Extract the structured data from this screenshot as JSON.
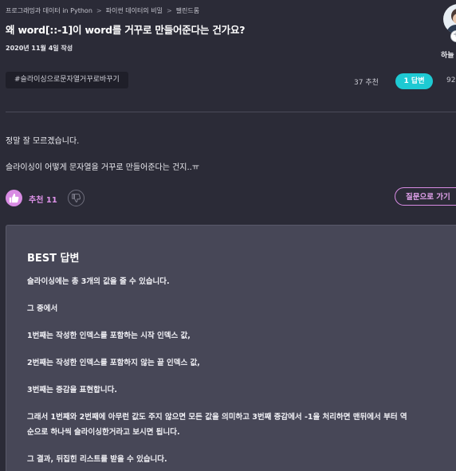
{
  "breadcrumb": {
    "items": [
      "프로그래밍과 데이터 in Python",
      "파이썬 데이터의 비밀",
      "팰린드롬"
    ],
    "separator": ">"
  },
  "question": {
    "title": "왜 word[::-1]이 word를 거꾸로 만들어준다는 건가요?",
    "date": "2020년 11월 4일 작성",
    "tag": "#슬라이싱으로문자열거꾸로바꾸기",
    "recommend_count": "37 추천",
    "answer_count": "1 답변",
    "views_partial": "92",
    "body": [
      "정말 잘 모르겠습니다.",
      "슬라이싱이 어떻게 문자열을 거꾸로 만들어준다는 건지..ㅠ"
    ]
  },
  "author": {
    "name_partial": "하늘"
  },
  "actions": {
    "like_label": "추천 11",
    "go_to_question_label": "질문으로 가기"
  },
  "best_answer": {
    "heading": "BEST 답변",
    "lines": [
      "슬라이싱에는 총 3개의 값을 줄 수 있습니다.",
      "그 중에서",
      "1번째는 작성한 인덱스를 포함하는 시작 인덱스 값,",
      "2번째는 작성한 인덱스를 포함하지 않는 끝 인덱스 값,",
      "3번째는 증감을 표현합니다.",
      "그래서 1번째와 2번째에 아무런 값도 주지 않으면 모든 값을 의미하고 3번째 증감에서 -1을 처리하면 맨뒤에서 부터 역",
      "순으로 하나씩 슬라이싱한거라고 보시면 됩니다.",
      "그 결과, 뒤집힌 리스트를 받을 수 있습니다."
    ]
  },
  "colors": {
    "background": "#2b2b37",
    "accent_teal": "#1ecad3",
    "accent_purple": "#d88be3",
    "card": "#474757"
  },
  "icons": [
    "thumbs-up-icon",
    "thumbs-down-icon",
    "avatar",
    "follow-badge-icon"
  ]
}
